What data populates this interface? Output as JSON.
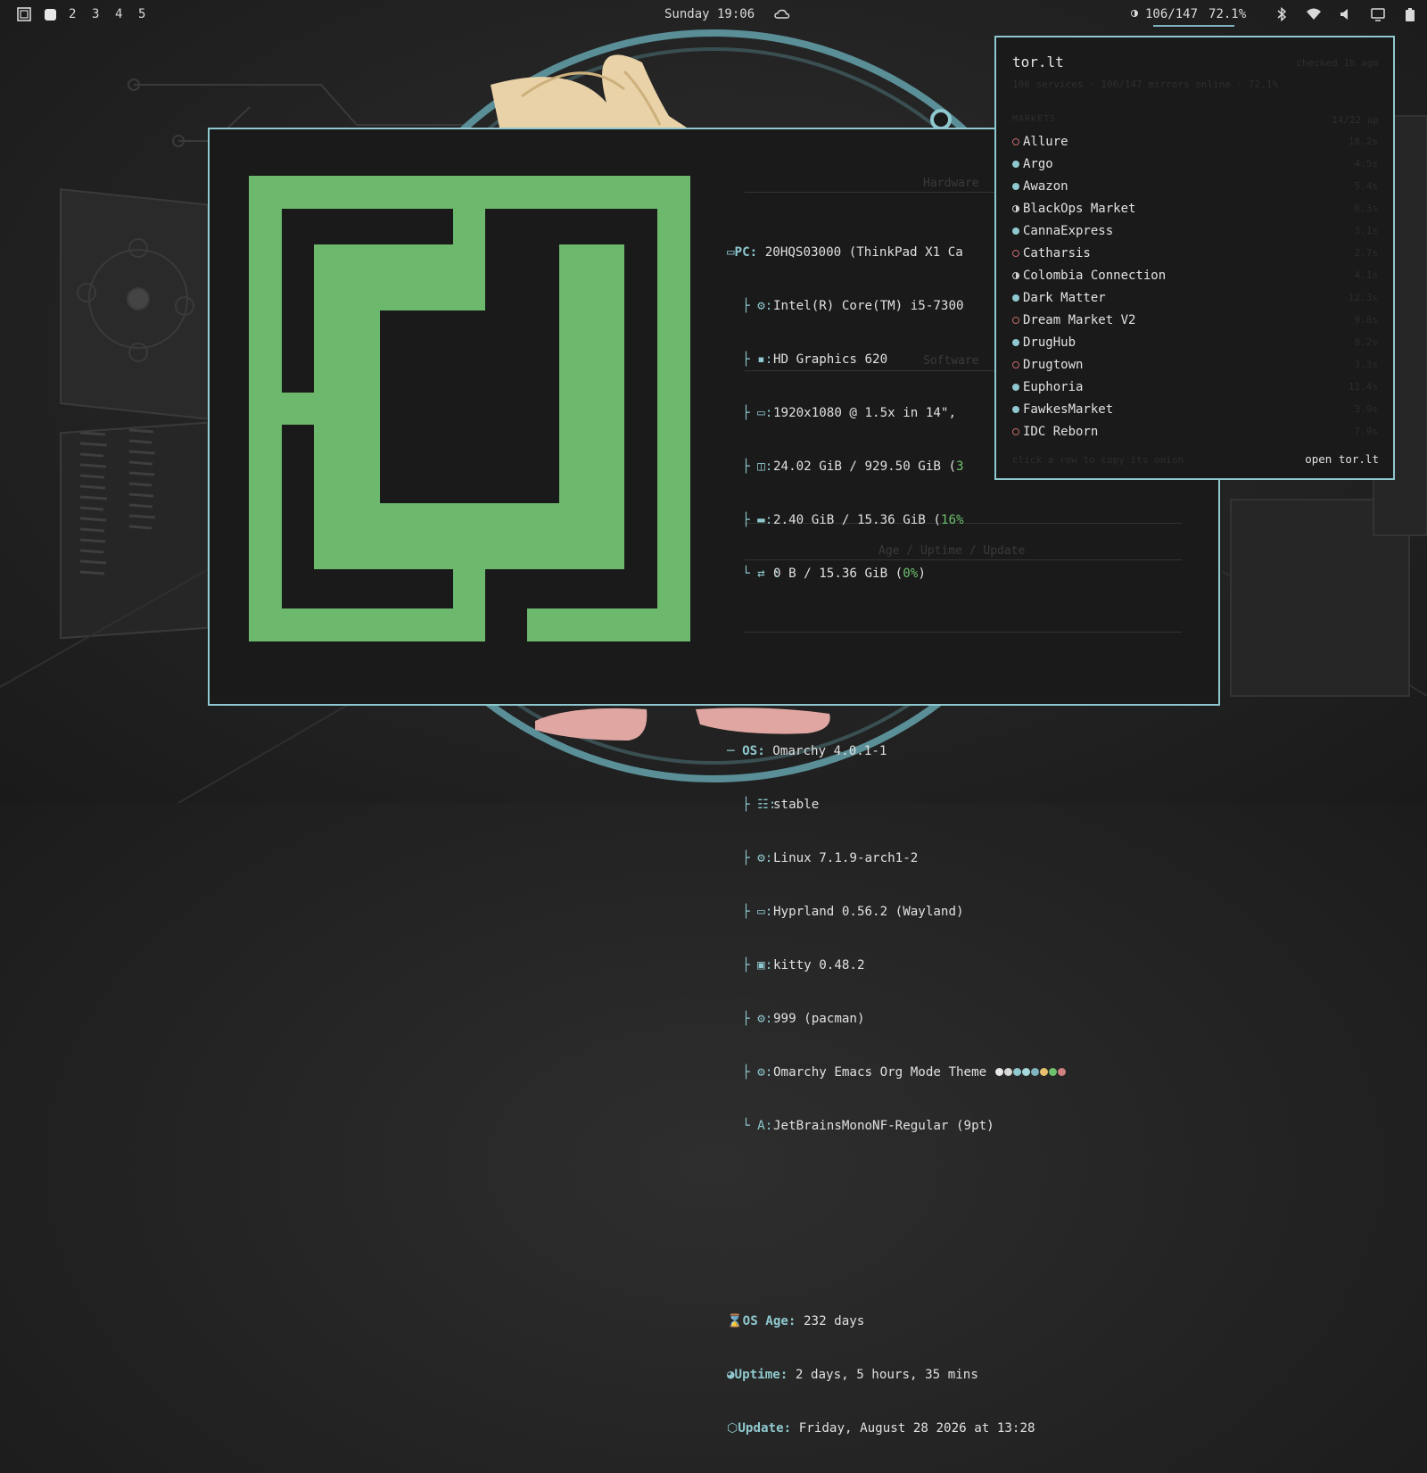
{
  "topbar": {
    "workspaces": [
      "2",
      "3",
      "4",
      "5"
    ],
    "clock": "Sunday 19:06",
    "counter": "106/147",
    "battery_pct": "72.1%",
    "icons": [
      "cloud-icon",
      "bluetooth-icon",
      "wifi-icon",
      "volume-icon",
      "monitor-icon",
      "battery-icon"
    ]
  },
  "terminal": {
    "sections": {
      "hardware": "Hardware",
      "software": "Software",
      "age": "Age / Uptime / Update"
    },
    "hardware": [
      {
        "label": "PC",
        "value": "20HQS03000 (ThinkPad X1 Ca"
      },
      {
        "label": "",
        "value": "Intel(R) Core(TM) i5-7300"
      },
      {
        "label": "",
        "value": "HD Graphics 620"
      },
      {
        "label": "",
        "value": "1920x1080 @ 1.5x in 14\", "
      },
      {
        "label": "",
        "value": "24.02 GiB / 929.50 GiB (",
        "pct": "3"
      },
      {
        "label": "",
        "value": "2.40 GiB / 15.36 GiB (",
        "pct": "16%"
      },
      {
        "label": "",
        "value": "0 B / 15.36 GiB (",
        "pct": "0%",
        "suffix": ")"
      }
    ],
    "software": [
      {
        "label": "OS",
        "value": "Omarchy 4.0.1-1"
      },
      {
        "label": "",
        "value": "stable"
      },
      {
        "label": "",
        "value": "Linux 7.1.9-arch1-2"
      },
      {
        "label": "",
        "value": "Hyprland 0.56.2 (Wayland)"
      },
      {
        "label": "",
        "value": "kitty 0.48.2"
      },
      {
        "label": "",
        "value": "999 (pacman)"
      },
      {
        "label": "",
        "value": "Omarchy Emacs Org Mode Theme"
      },
      {
        "label": "",
        "value": "JetBrainsMonoNF-Regular (9pt)"
      }
    ],
    "theme_dots": [
      "#e8e8e8",
      "#d8d8d8",
      "#8fc8cf",
      "#a8d8de",
      "#7fb3bf",
      "#e8c070",
      "#6ec06e",
      "#d08080"
    ],
    "age": [
      {
        "label": "OS Age",
        "value": "232 days"
      },
      {
        "label": "Uptime",
        "value": "2 days, 5 hours, 35 mins"
      },
      {
        "label": "Update",
        "value": "Friday, August 28 2026 at 13:28"
      }
    ]
  },
  "tor": {
    "title": "tor.lt",
    "status": "checked 1h ago",
    "summary": "106 services · 106/147 mirrors online · 72.1%",
    "markets_header": "MARKETS",
    "markets_count": "14/22 up",
    "markets": [
      {
        "name": "Allure",
        "status": "offline",
        "lat": "18.2s"
      },
      {
        "name": "Argo",
        "status": "online",
        "lat": "4.5s"
      },
      {
        "name": "Awazon",
        "status": "online",
        "lat": "5.4s"
      },
      {
        "name": "BlackOps Market",
        "status": "half",
        "lat": "6.3s"
      },
      {
        "name": "CannaExpress",
        "status": "online",
        "lat": "3.1s"
      },
      {
        "name": "Catharsis",
        "status": "offline",
        "lat": "2.7s"
      },
      {
        "name": "Colombia Connection",
        "status": "half",
        "lat": "4.1s"
      },
      {
        "name": "Dark Matter",
        "status": "online",
        "lat": "12.3s"
      },
      {
        "name": "Dream Market V2",
        "status": "offline",
        "lat": "9.8s"
      },
      {
        "name": "DrugHub",
        "status": "online",
        "lat": "8.2s"
      },
      {
        "name": "Drugtown",
        "status": "offline",
        "lat": "3.3s"
      },
      {
        "name": "Euphoria",
        "status": "online",
        "lat": "11.4s"
      },
      {
        "name": "FawkesMarket",
        "status": "online",
        "lat": "3.9s"
      },
      {
        "name": "IDC Reborn",
        "status": "offline",
        "lat": "7.9s"
      }
    ],
    "hint": "click a row to copy its onion",
    "open_label": "open tor.lt"
  }
}
